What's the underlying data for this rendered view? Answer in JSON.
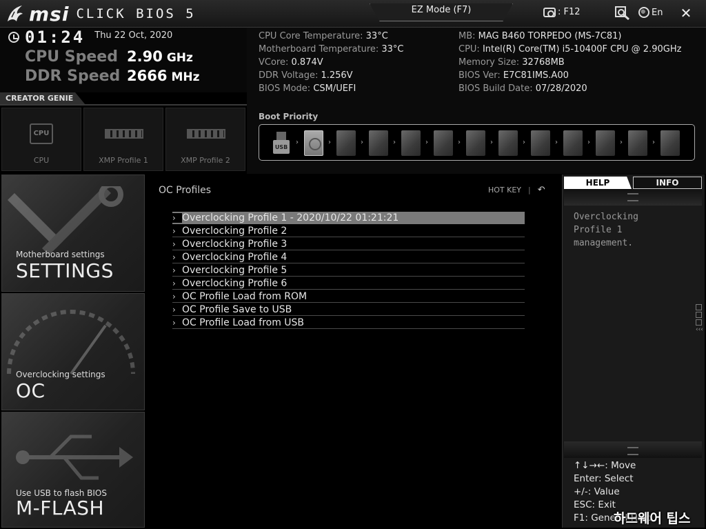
{
  "topbar": {
    "brand": "msi",
    "bios_name": "CLICK BIOS 5",
    "ez_mode_label": "EZ Mode (F7)",
    "screenshot_label": ": F12",
    "lang_label": "En"
  },
  "status": {
    "time": "01:24",
    "date": "Thu  22 Oct, 2020",
    "cpu_speed_label": "CPU Speed",
    "cpu_speed_value": "2.90",
    "cpu_speed_unit": "GHz",
    "ddr_speed_label": "DDR Speed",
    "ddr_speed_value": "2666",
    "ddr_speed_unit": "MHz"
  },
  "sysinfo": {
    "left": [
      {
        "label": "CPU Core Temperature:",
        "value": "33°C"
      },
      {
        "label": "Motherboard Temperature:",
        "value": "33°C"
      },
      {
        "label": "VCore:",
        "value": "0.874V"
      },
      {
        "label": "DDR Voltage:",
        "value": "1.256V"
      },
      {
        "label": "BIOS Mode:",
        "value": "CSM/UEFI"
      }
    ],
    "right": [
      {
        "label": "MB:",
        "value": "MAG B460 TORPEDO (MS-7C81)"
      },
      {
        "label": "CPU:",
        "value": "Intel(R) Core(TM) i5-10400F CPU @ 2.90GHz"
      },
      {
        "label": "Memory Size:",
        "value": "32768MB"
      },
      {
        "label": "BIOS Ver:",
        "value": "E7C81IMS.A00"
      },
      {
        "label": "BIOS Build Date:",
        "value": "07/28/2020"
      }
    ]
  },
  "boot": {
    "title": "Boot Priority",
    "usb_label": "USB",
    "devices": [
      "usb",
      "hdd",
      "empty",
      "empty",
      "empty",
      "empty",
      "empty",
      "empty",
      "empty",
      "empty",
      "empty",
      "empty",
      "empty"
    ]
  },
  "genie": {
    "title": "CREATOR GENIE",
    "tiles": [
      {
        "label": "CPU",
        "chip": "CPU"
      },
      {
        "label": "XMP Profile 1"
      },
      {
        "label": "XMP Profile 2"
      }
    ]
  },
  "sidebar": {
    "items": [
      {
        "sub": "Motherboard settings",
        "main": "SETTINGS"
      },
      {
        "sub": "Overclocking settings",
        "main": "OC"
      },
      {
        "sub": "Use USB to flash BIOS",
        "main": "M-FLASH"
      }
    ]
  },
  "main": {
    "title": "OC Profiles",
    "hotkey": "HOT KEY",
    "sep": "|",
    "options": [
      "Overclocking Profile 1 - 2020/10/22 01:21:21",
      "Overclocking Profile 2",
      "Overclocking Profile 3",
      "Overclocking Profile 4",
      "Overclocking Profile 5",
      "Overclocking Profile 6",
      "OC Profile Load from ROM",
      "OC Profile Save to USB",
      "OC Profile Load from USB"
    ],
    "selected_index": 0
  },
  "help": {
    "tab_help": "HELP",
    "tab_info": "INFO",
    "text": "Overclocking Profile 1 management.",
    "keys": [
      "↑↓→←: Move",
      "Enter: Select",
      "+/-: Value",
      "ESC: Exit",
      "F1: General Help"
    ]
  },
  "watermark": "하드웨어 팁스"
}
